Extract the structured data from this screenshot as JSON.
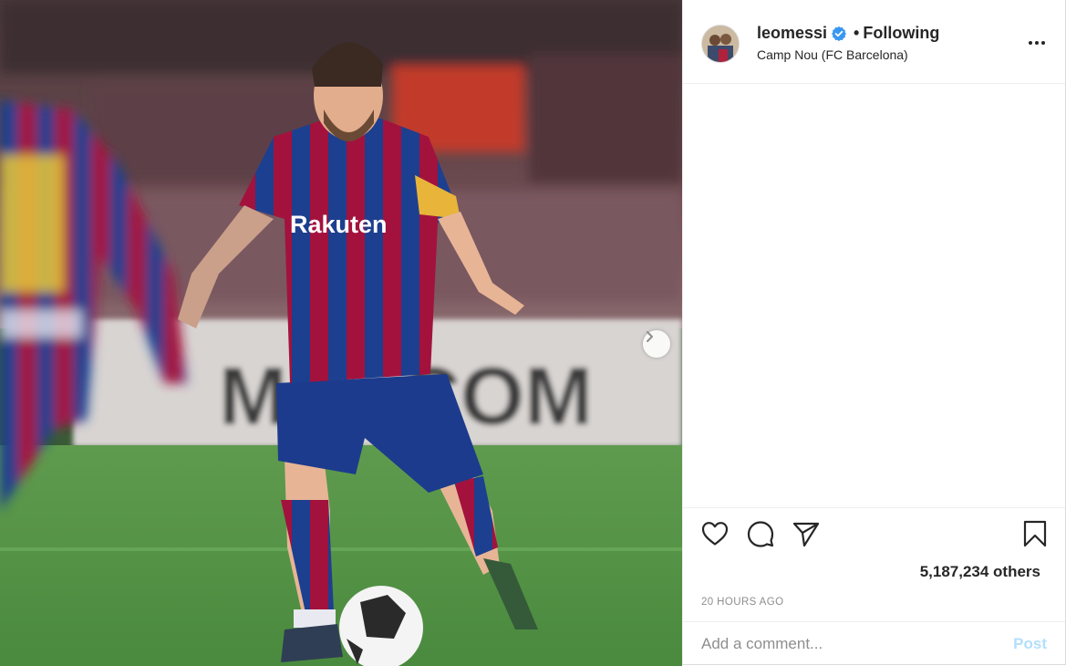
{
  "post": {
    "username": "leomessi",
    "follow_state": "Following",
    "separator": "•",
    "location": "Camp Nou (FC Barcelona)",
    "likes_text": "5,187,234 others",
    "timestamp": "20 HOURS AGO"
  },
  "comment": {
    "placeholder": "Add a comment...",
    "post_label": "Post"
  },
  "icons": {
    "verified": "verified-badge-icon",
    "more": "more-options-icon",
    "like": "heart-icon",
    "comment": "comment-bubble-icon",
    "share": "paper-plane-icon",
    "save": "bookmark-icon",
    "next": "chevron-right-icon"
  },
  "colors": {
    "verified_blue": "#3897f0",
    "post_disabled": "#b2dffc",
    "muted_text": "#8e8e8e",
    "text": "#262626"
  }
}
